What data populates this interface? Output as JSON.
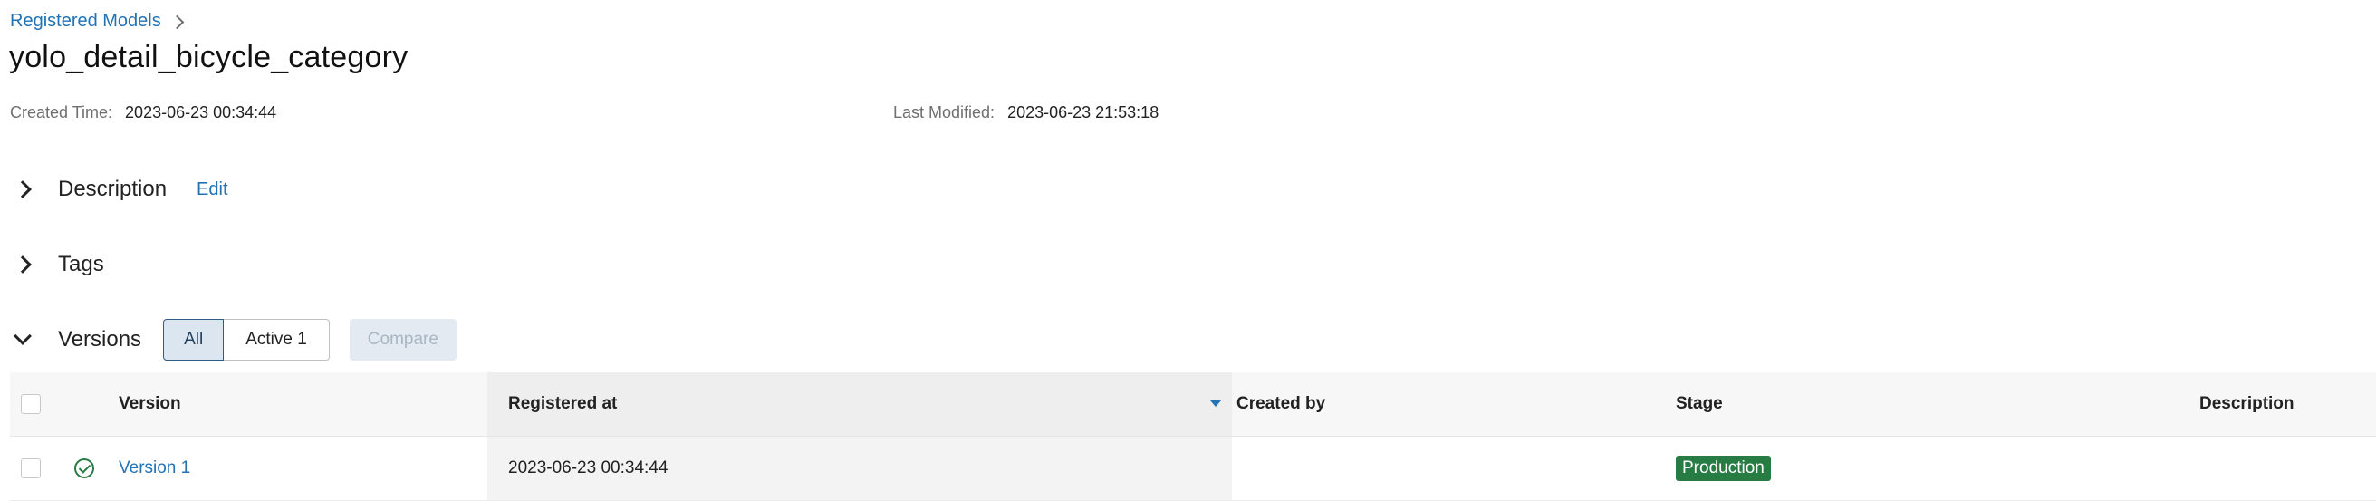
{
  "breadcrumb": {
    "parent": "Registered Models"
  },
  "model": {
    "name": "yolo_detail_bicycle_category",
    "created_label": "Created Time:",
    "created_value": "2023-06-23 00:34:44",
    "modified_label": "Last Modified:",
    "modified_value": "2023-06-23 21:53:18"
  },
  "sections": {
    "description": {
      "title": "Description",
      "edit": "Edit"
    },
    "tags": {
      "title": "Tags"
    },
    "versions": {
      "title": "Versions",
      "filter_all": "All",
      "filter_active": "Active 1",
      "compare": "Compare"
    }
  },
  "table": {
    "columns": {
      "version": "Version",
      "registered_at": "Registered at",
      "created_by": "Created by",
      "stage": "Stage",
      "description": "Description"
    },
    "sort_direction": "descending",
    "rows": [
      {
        "version": "Version 1",
        "registered_at": "2023-06-23 00:34:44",
        "created_by": "",
        "stage": "Production",
        "description": "",
        "status_icon": "check-circle-icon"
      }
    ]
  },
  "colors": {
    "link": "#2272b4",
    "stage_production": "#277c43",
    "filter_selected_bg": "#dbe6f0"
  }
}
